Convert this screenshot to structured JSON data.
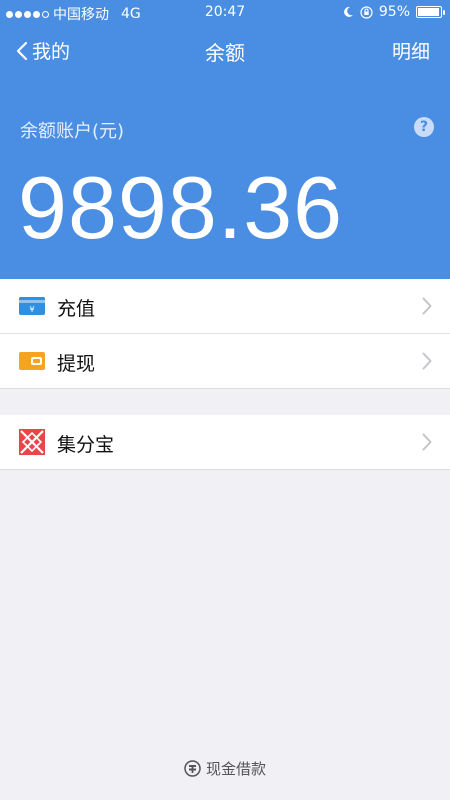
{
  "status_bar": {
    "carrier": "中国移动",
    "network": "4G",
    "time": "20:47",
    "battery": "95%",
    "battery_level": 0.95
  },
  "nav": {
    "back_label": "我的",
    "title": "余额",
    "detail_label": "明细"
  },
  "account": {
    "label": "余额账户(元)",
    "help_glyph": "?",
    "balance": "9898.36"
  },
  "menu_group1": [
    {
      "label": "充值",
      "icon": "recharge-card-icon"
    },
    {
      "label": "提现",
      "icon": "withdraw-wallet-icon"
    }
  ],
  "menu_group2": [
    {
      "label": "集分宝",
      "icon": "jifenbao-icon"
    }
  ],
  "footer": {
    "label": "现金借款",
    "icon": "cash-loan-icon"
  },
  "colors": {
    "accent": "#4a8ee4",
    "recharge_icon": "#2f8fe0",
    "withdraw_icon": "#f5a41f",
    "jifenbao_icon": "#e8474a"
  }
}
